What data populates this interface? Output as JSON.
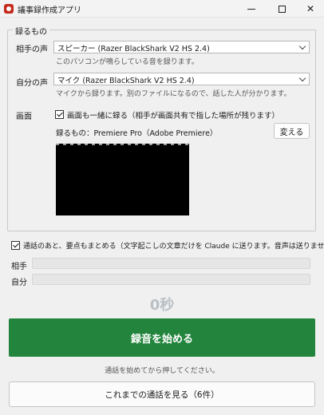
{
  "window": {
    "title": "議事録作成アプリ"
  },
  "recording_group": {
    "legend": "録るもの",
    "partner_voice": {
      "label": "相手の声",
      "selected": "スピーカー (Razer BlackShark V2 HS 2.4)",
      "hint": "このパソコンが鳴らしている音を録ります。"
    },
    "own_voice": {
      "label": "自分の声",
      "selected": "マイク (Razer BlackShark V2 HS 2.4)",
      "hint": "マイクから録ります。別のファイルになるので、話した人が分かります。"
    },
    "screen": {
      "label": "画面",
      "checkbox_label": "画面も一緒に録る（相手が画面共有で指した場所が残ります）",
      "checked": true,
      "target_text": "録るもの：Premiere Pro（Adobe Premiere）",
      "change_button": "変える"
    }
  },
  "summary_option": {
    "label": "通話のあと、要点もまとめる（文字起こしの文章だけを Claude に送ります。音声は送りません）",
    "checked": true
  },
  "transcripts": {
    "partner_label": "相手",
    "self_label": "自分"
  },
  "timer": "0秒",
  "record_button": "録音を始める",
  "record_hint": "通話を始めてから押してください。",
  "history_button": "これまでの通話を見る（6件）",
  "colors": {
    "record_button": "#23853d",
    "timer": "#b9c0c6",
    "app_icon": "#c42b1c"
  }
}
